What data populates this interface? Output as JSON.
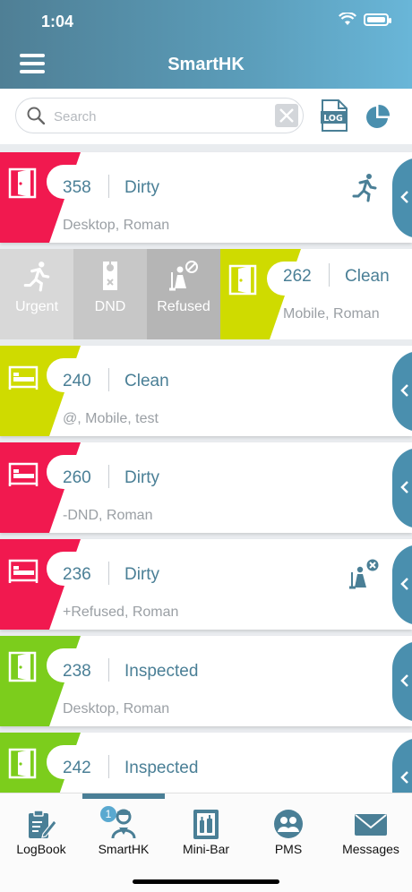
{
  "status_bar": {
    "time": "1:04"
  },
  "header": {
    "title": "SmartHK"
  },
  "search": {
    "placeholder": "Search"
  },
  "colors": {
    "dirty": "#f1194f",
    "clean": "#cfdb00",
    "inspected": "#7ccd1c",
    "accent": "#4a7f96",
    "handle": "#4a8fae"
  },
  "rooms": [
    {
      "number": "358",
      "status": "Dirty",
      "info": "Desktop, Roman",
      "icon": "door-icon",
      "badge": "running-person-icon"
    },
    {
      "number": "262",
      "status": "Clean",
      "info": "Mobile, Roman",
      "icon": "door-icon"
    },
    {
      "number": "240",
      "status": "Clean",
      "info": "@, Mobile, test",
      "icon": "bed-icon"
    },
    {
      "number": "260",
      "status": "Dirty",
      "info": "-DND, Roman",
      "icon": "bed-icon"
    },
    {
      "number": "236",
      "status": "Dirty",
      "info": "+Refused, Roman",
      "icon": "bed-icon",
      "badge": "refused-housekeeper-icon"
    },
    {
      "number": "238",
      "status": "Inspected",
      "info": "Desktop, Roman",
      "icon": "door-icon"
    },
    {
      "number": "242",
      "status": "Inspected",
      "info": "",
      "icon": "door-icon"
    }
  ],
  "swipe_actions": {
    "urgent": "Urgent",
    "dnd": "DND",
    "refused": "Refused"
  },
  "tabs": [
    {
      "label": "LogBook",
      "icon": "logbook-icon"
    },
    {
      "label": "SmartHK",
      "icon": "housekeeper-icon",
      "badge": "1",
      "active": true
    },
    {
      "label": "Mini-Bar",
      "icon": "minibar-icon"
    },
    {
      "label": "PMS",
      "icon": "people-icon"
    },
    {
      "label": "Messages",
      "icon": "envelope-icon"
    }
  ]
}
